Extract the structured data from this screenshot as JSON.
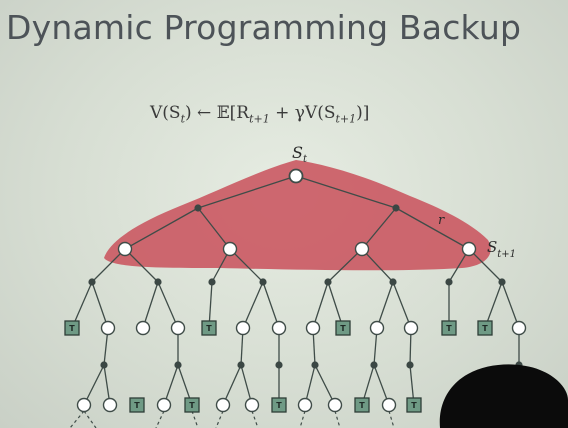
{
  "slide": {
    "title": "Dynamic Programming Backup",
    "equation": {
      "lhs": "V(S",
      "lhs_sub": "t",
      "arrow": "←",
      "rhs_start": "𝔼[R",
      "rhs_sub": "t+1",
      "rhs_mid": " + γV(S",
      "rhs_sub2": "t+1",
      "rhs_end": ")]"
    },
    "labels": {
      "root": "S",
      "root_sub": "t",
      "next": "S",
      "next_sub": "t+1",
      "reward_glyph": "r"
    },
    "terminal_label": "T",
    "colors": {
      "highlight": "#c9545f",
      "terminal": "#6f9a85",
      "background": "#d7dfd4"
    }
  }
}
